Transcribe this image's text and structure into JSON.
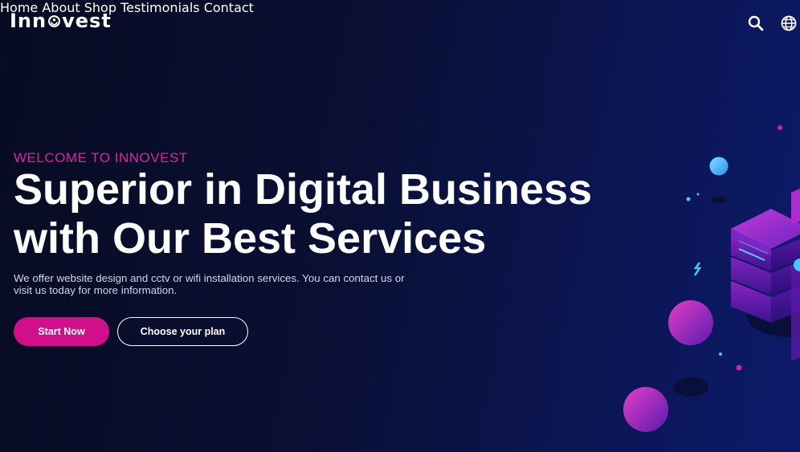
{
  "brand": {
    "name_prefix": "Inn",
    "name_suffix": "vest"
  },
  "nav": {
    "items": [
      {
        "label": "Home"
      },
      {
        "label": "About"
      },
      {
        "label": "Shop"
      },
      {
        "label": "Testimonials"
      },
      {
        "label": "Contact"
      }
    ],
    "search_icon": "search-icon",
    "language_icon": "globe-icon"
  },
  "hero": {
    "eyebrow": "WELCOME TO INNOVEST",
    "headline_line1": "Superior in Digital Business",
    "headline_line2": "with Our Best Services",
    "description_line1": "We offer website design and cctv or wifi installation services. You can contact us or",
    "description_line2": "visit us today for more information.",
    "primary_button": "Start Now",
    "secondary_button": "Choose your plan"
  },
  "colors": {
    "accent": "#e2239b",
    "primary_button": "#d10f8a",
    "background_dark": "#070b22",
    "background_blue": "#0c1a6b"
  }
}
